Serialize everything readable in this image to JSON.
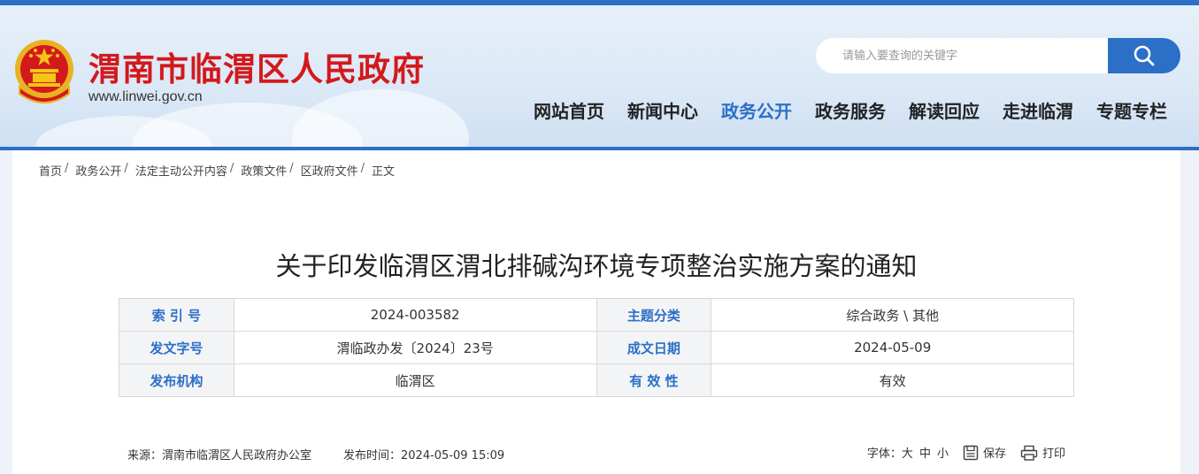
{
  "header": {
    "site_title": "渭南市临渭区人民政府",
    "site_url": "www.linwei.gov.cn",
    "search_placeholder": "请输入要查询的关键字",
    "brand_color": "#2b6fc7",
    "title_color": "#d3191c"
  },
  "nav": {
    "items": [
      {
        "label": "网站首页",
        "active": false
      },
      {
        "label": "新闻中心",
        "active": false
      },
      {
        "label": "政务公开",
        "active": true
      },
      {
        "label": "政务服务",
        "active": false
      },
      {
        "label": "解读回应",
        "active": false
      },
      {
        "label": "走进临渭",
        "active": false
      },
      {
        "label": "专题专栏",
        "active": false
      }
    ]
  },
  "breadcrumb": {
    "items": [
      "首页",
      "政务公开",
      "法定主动公开内容",
      "政策文件",
      "区政府文件",
      "正文"
    ],
    "separator": "/"
  },
  "document": {
    "title": "关于印发临渭区渭北排碱沟环境专项整治实施方案的通知",
    "meta": [
      {
        "label1": "索 引 号",
        "value1": "2024-003582",
        "label2": "主题分类",
        "value2": "综合政务 \\ 其他"
      },
      {
        "label1": "发文字号",
        "value1": "渭临政办发〔2024〕23号",
        "label2": "成文日期",
        "value2": "2024-05-09"
      },
      {
        "label1": "发布机构",
        "value1": "临渭区",
        "label2": "有 效 性",
        "value2": "有效"
      }
    ],
    "source": "来源：渭南市临渭区人民政府办公室",
    "publish_time": "发布时间：2024-05-09 15:09",
    "font_label": "字体：",
    "font_large": "大",
    "font_medium": "中",
    "font_small": "小",
    "save_label": "保存",
    "print_label": "打印"
  }
}
